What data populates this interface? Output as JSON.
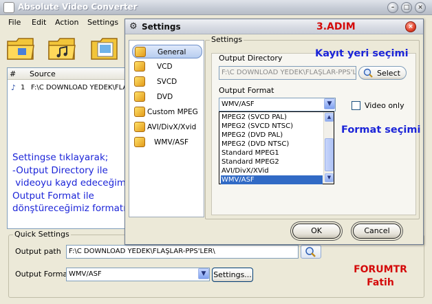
{
  "main_window": {
    "title": "Absolute Video Converter",
    "menu": [
      "File",
      "Edit",
      "Action",
      "Settings"
    ],
    "list_headers": {
      "index": "#",
      "source": "Source"
    },
    "row": {
      "index": "1",
      "source": "F:\\C DOWNLOAD YEDEK\\FLA"
    }
  },
  "instruction_text": "Settingse tıklayarak;\n-Output Directory ile\n videoyu kayd edeceğimiz yeri\nOutput Format ile\ndönştüreceğimiz formatı seçeriz.",
  "quick_settings": {
    "legend": "Quick Settings",
    "output_path_label": "Output path",
    "output_path_value": "F:\\C DOWNLOAD YEDEK\\FLAŞLAR-PPS'LER\\",
    "output_format_label": "Output Format",
    "output_format_value": "WMV/ASF",
    "settings_button": "Settings..."
  },
  "settings_dialog": {
    "title": "Settings",
    "step_label": "3.ADIM",
    "nav_items": [
      "General",
      "VCD",
      "SVCD",
      "DVD",
      "Custom MPEG",
      "AVI/DivX/Xvid",
      "WMV/ASF"
    ],
    "group_legend": "Settings",
    "output_directory_label": "Output Directory",
    "output_directory_value": "F:\\C DOWNLOAD YEDEK\\FLAŞLAR-PPS'LER\\",
    "select_button": "Select",
    "output_format_label": "Output Format",
    "output_format_value": "WMV/ASF",
    "video_only_label": "Video only",
    "format_options": [
      "MPEG2 (SVCD PAL)",
      "MPEG2 (SVCD NTSC)",
      "MPEG2 (DVD PAL)",
      "MPEG2 (DVD NTSC)",
      "Standard MPEG1",
      "Standard MPEG2",
      "AVI/DivX/XVid",
      "WMV/ASF"
    ],
    "ok_button": "OK",
    "cancel_button": "Cancel"
  },
  "annotations": {
    "save_location": "Kayıt yeri seçimi",
    "format_choice": "Format seçimi",
    "credit_line1": "FORUMTR",
    "credit_line2": "Fatih"
  },
  "colors": {
    "annotation_blue": "#1b24d8",
    "annotation_red": "#d40a0a",
    "selection": "#316ac5"
  }
}
